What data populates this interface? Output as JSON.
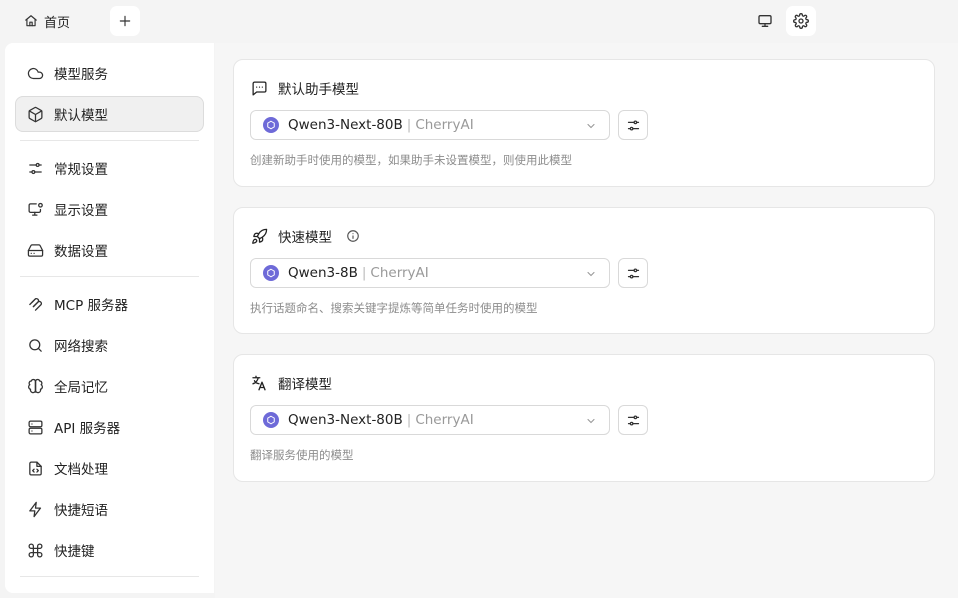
{
  "topbar": {
    "home_label": "首页",
    "home_icon": "home-icon",
    "add_icon": "plus-icon",
    "monitor_icon": "monitor-icon",
    "settings_icon": "gear-icon"
  },
  "sidebar": {
    "items": [
      {
        "label": "模型服务",
        "icon": "cloud-icon"
      },
      {
        "label": "默认模型",
        "icon": "cube-icon",
        "active": true
      },
      {
        "label": "常规设置",
        "icon": "sliders-icon"
      },
      {
        "label": "显示设置",
        "icon": "monitor-settings-icon"
      },
      {
        "label": "数据设置",
        "icon": "hard-drive-icon"
      },
      {
        "label": "MCP 服务器",
        "icon": "mcp-icon"
      },
      {
        "label": "网络搜索",
        "icon": "search-icon"
      },
      {
        "label": "全局记忆",
        "icon": "brain-icon"
      },
      {
        "label": "API 服务器",
        "icon": "server-icon"
      },
      {
        "label": "文档处理",
        "icon": "file-code-icon"
      },
      {
        "label": "快捷短语",
        "icon": "zap-icon"
      },
      {
        "label": "快捷键",
        "icon": "command-icon"
      }
    ]
  },
  "cards": [
    {
      "title": "默认助手模型",
      "icon": "message-icon",
      "model_name": "Qwen3-Next-80B",
      "separator": "|",
      "provider": "CherryAI",
      "description": "创建新助手时使用的模型，如果助手未设置模型，则使用此模型"
    },
    {
      "title": "快速模型",
      "icon": "rocket-icon",
      "model_name": "Qwen3-8B",
      "separator": "|",
      "provider": "CherryAI",
      "description": "执行话题命名、搜索关键字提炼等简单任务时使用的模型"
    },
    {
      "title": "翻译模型",
      "icon": "translate-icon",
      "model_name": "Qwen3-Next-80B",
      "separator": "|",
      "provider": "CherryAI",
      "description": "翻译服务使用的模型"
    }
  ],
  "colors": {
    "model_logo": "#6e6ad8",
    "active_nav_bg": "#f0f0f0",
    "muted_text": "#8c8c8c"
  }
}
